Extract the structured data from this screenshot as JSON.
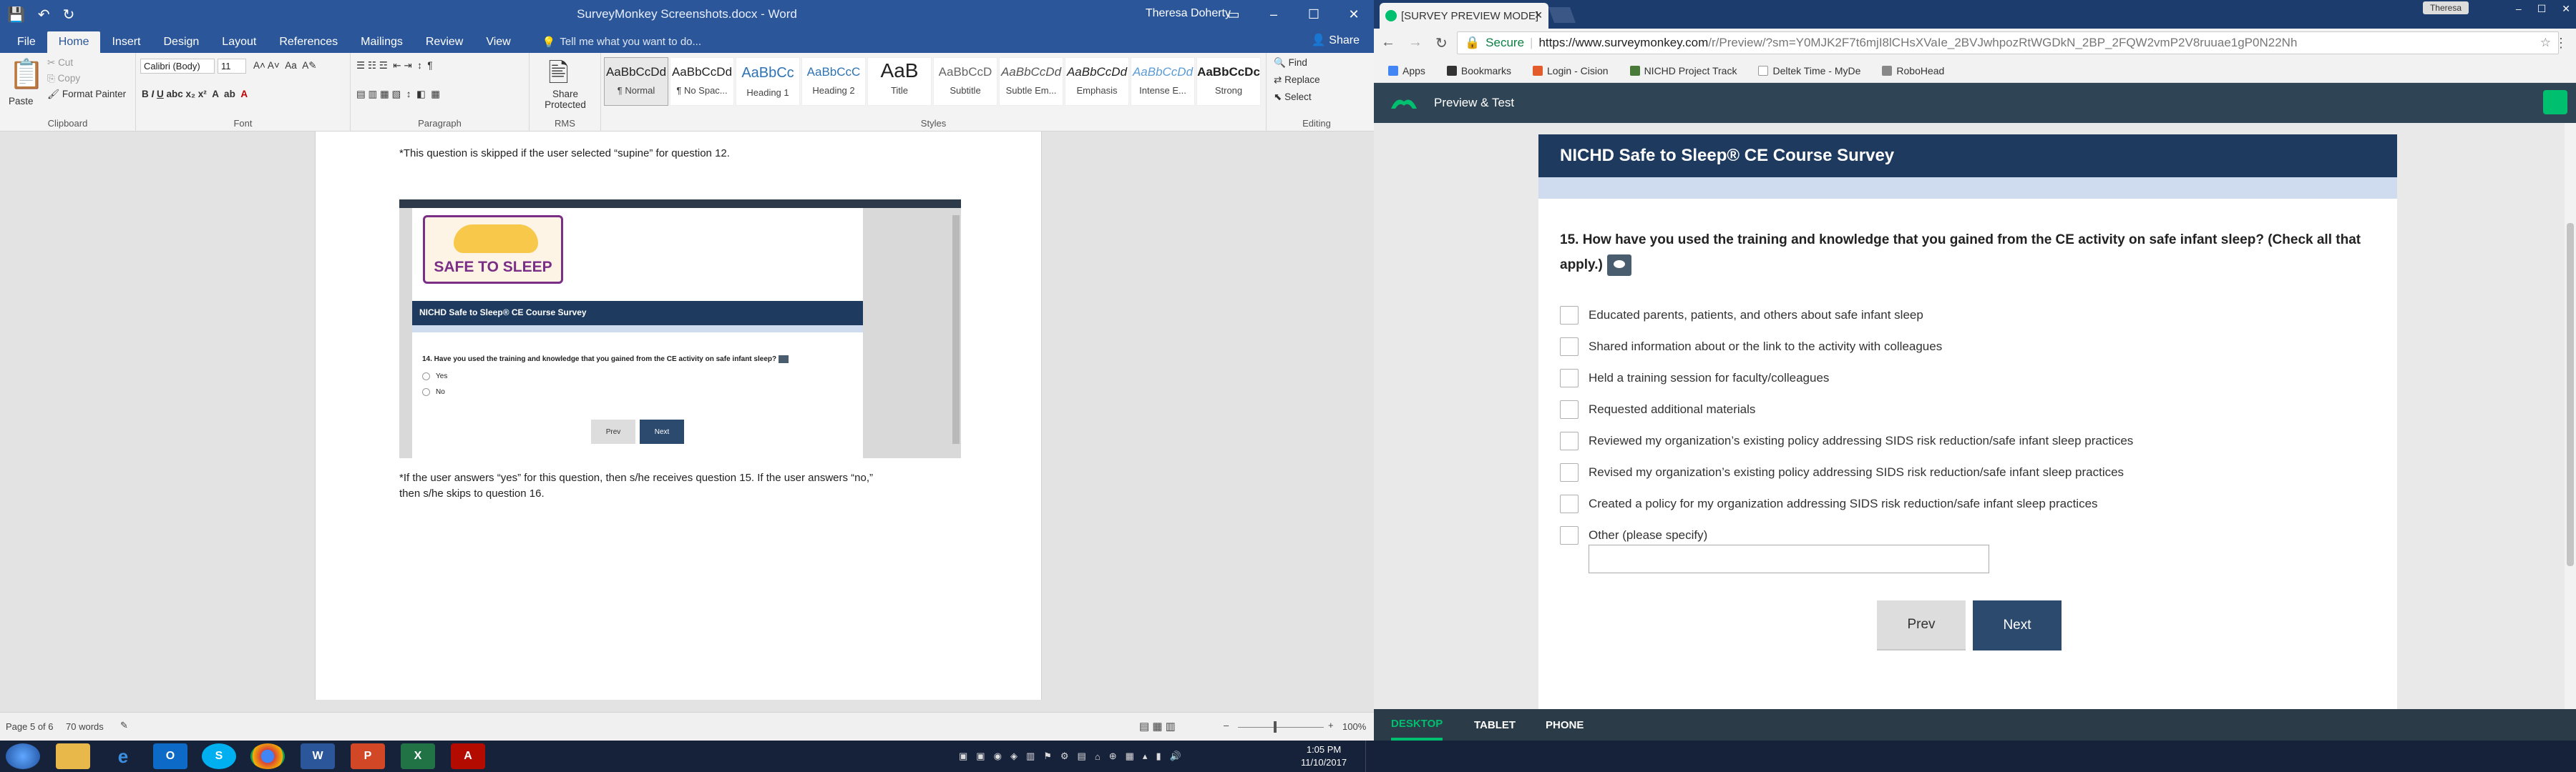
{
  "word": {
    "title": "SurveyMonkey Screenshots.docx - Word",
    "user": "Theresa Doherty",
    "share": "Share",
    "tabs": [
      "File",
      "Home",
      "Insert",
      "Design",
      "Layout",
      "References",
      "Mailings",
      "Review",
      "View"
    ],
    "tell_me": "Tell me what you want to do...",
    "clipboard": {
      "paste": "Paste",
      "cut": "Cut",
      "copy": "Copy",
      "format_painter": "Format Painter",
      "label": "Clipboard"
    },
    "font": {
      "name": "Calibri (Body)",
      "size": "11",
      "label": "Font"
    },
    "paragraph_label": "Paragraph",
    "rms": {
      "button": "Share Protected",
      "label": "RMS"
    },
    "styles": [
      {
        "sample": "AaBbCcDd",
        "name": "¶ Normal"
      },
      {
        "sample": "AaBbCcDd",
        "name": "¶ No Spac..."
      },
      {
        "sample": "AaBbCc",
        "name": "Heading 1"
      },
      {
        "sample": "AaBbCcC",
        "name": "Heading 2"
      },
      {
        "sample": "AaB",
        "name": "Title"
      },
      {
        "sample": "AaBbCcD",
        "name": "Subtitle"
      },
      {
        "sample": "AaBbCcDd",
        "name": "Subtle Em..."
      },
      {
        "sample": "AaBbCcDd",
        "name": "Emphasis"
      },
      {
        "sample": "AaBbCcDd",
        "name": "Intense E..."
      },
      {
        "sample": "AaBbCcDc",
        "name": "Strong"
      }
    ],
    "styles_label": "Styles",
    "editing": {
      "find": "Find",
      "replace": "Replace",
      "select": "Select",
      "label": "Editing"
    },
    "doc": {
      "note1": "*This question is skipped if the user selected “supine” for question 12.",
      "note2_line1": "*If the user answers “yes” for this question, then s/he receives question 15. If the user answers “no,”",
      "note2_line2": "then s/he skips to question 16.",
      "embedded": {
        "logo_text": "SAFE TO SLEEP",
        "header": "NICHD Safe to Sleep® CE Course Survey",
        "question": "14. Have you used the training and knowledge that you gained from the CE activity on safe infant sleep?",
        "options": [
          "Yes",
          "No"
        ],
        "prev": "Prev",
        "next": "Next"
      }
    },
    "status": {
      "page": "Page 5 of 6",
      "words": "70 words",
      "zoom": "100%"
    }
  },
  "chrome": {
    "tab_title": "[SURVEY PREVIEW MODE]",
    "user": "Theresa",
    "secure": "Secure",
    "url_host": "https://www.surveymonkey.com",
    "url_path": "/r/Preview/?sm=Y0MJK2F7t6mjI8lCHsXVaIe_2BVJwhpozRtWGDkN_2BP_2FQW2vmP2V8ruuae1gP0N22Nh",
    "bookmarks": [
      "Apps",
      "Bookmarks",
      "Login - Cision",
      "NICHD Project Track",
      "Deltek Time - MyDe",
      "RoboHead"
    ]
  },
  "surveymonkey": {
    "toolbar_title": "Preview & Test",
    "survey_title": "NICHD Safe to Sleep® CE Course Survey",
    "question": "15. How have you used the training and knowledge that you gained from the CE activity on safe infant sleep? (Check all that apply.)",
    "options": [
      "Educated parents, patients, and others about safe infant sleep",
      "Shared information about or the link to the activity with colleagues",
      "Held a training session for faculty/colleagues",
      "Requested additional materials",
      "Reviewed my organization’s existing policy addressing SIDS risk reduction/safe infant sleep practices",
      "Revised my organization’s existing policy addressing SIDS risk reduction/safe infant sleep practices",
      "Created a policy for my organization addressing SIDS risk reduction/safe infant sleep practices",
      "Other (please specify)"
    ],
    "prev": "Prev",
    "next": "Next",
    "device_tabs": [
      "DESKTOP",
      "TABLET",
      "PHONE"
    ],
    "active_device": "DESKTOP"
  },
  "taskbar": {
    "apps": [
      "Explorer",
      "IE",
      "Outlook",
      "Skype",
      "Chrome",
      "Word",
      "PowerPoint",
      "Excel",
      "Acrobat"
    ],
    "time": "1:05 PM",
    "date": "11/10/2017"
  },
  "colors": {
    "word_blue": "#2b579a",
    "sm_green": "#00bf6f",
    "survey_navy": "#1e3a5f"
  }
}
